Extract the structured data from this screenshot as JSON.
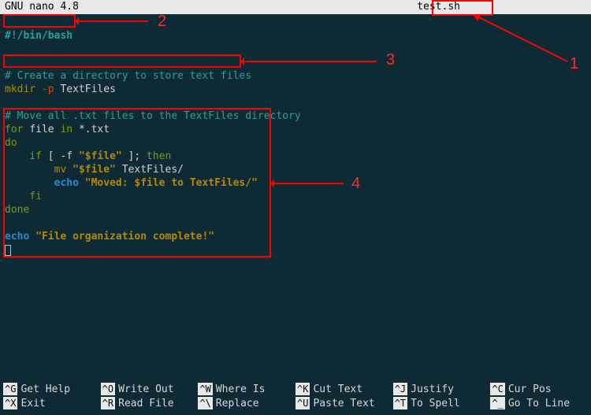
{
  "titlebar": {
    "app": "GNU nano 4.8",
    "filename": "test.sh"
  },
  "code": {
    "l1_shebang": "#!/bin/bash",
    "l4_comment": "# Create a directory to store text files",
    "l5_cmd": "mkdir",
    "l5_opt": "-p",
    "l5_arg": "TextFiles",
    "l8_comment": "# Move all .txt files to the TextFiles directory",
    "l9_for": "for",
    "l9_var": "file",
    "l9_in": "in",
    "l9_glob": "*.txt",
    "l10_do": "do",
    "l11_if": "if",
    "l11_cond": "[ -f \"$file\" ];",
    "l11_then": "then",
    "l11_str": "\"$file\"",
    "l12_mv": "mv",
    "l12_src": "\"$file\"",
    "l12_dst": "TextFiles/",
    "l13_echo": "echo",
    "l13_str": "\"Moved: $file to TextFiles/\"",
    "l14_fi": "fi",
    "l15_done": "done",
    "l17_echo": "echo",
    "l17_str": "\"File organization complete!\""
  },
  "help": [
    [
      {
        "key": "^G",
        "label": "Get Help"
      },
      {
        "key": "^O",
        "label": "Write Out"
      },
      {
        "key": "^W",
        "label": "Where Is"
      },
      {
        "key": "^K",
        "label": "Cut Text"
      },
      {
        "key": "^J",
        "label": "Justify"
      },
      {
        "key": "^C",
        "label": "Cur Pos"
      }
    ],
    [
      {
        "key": "^X",
        "label": "Exit"
      },
      {
        "key": "^R",
        "label": "Read File"
      },
      {
        "key": "^\\",
        "label": "Replace"
      },
      {
        "key": "^U",
        "label": "Paste Text"
      },
      {
        "key": "^T",
        "label": "To Spell"
      },
      {
        "key": "^_",
        "label": "Go To Line"
      }
    ]
  ],
  "annotations": {
    "n1": "1",
    "n2": "2",
    "n3": "3",
    "n4": "4"
  }
}
